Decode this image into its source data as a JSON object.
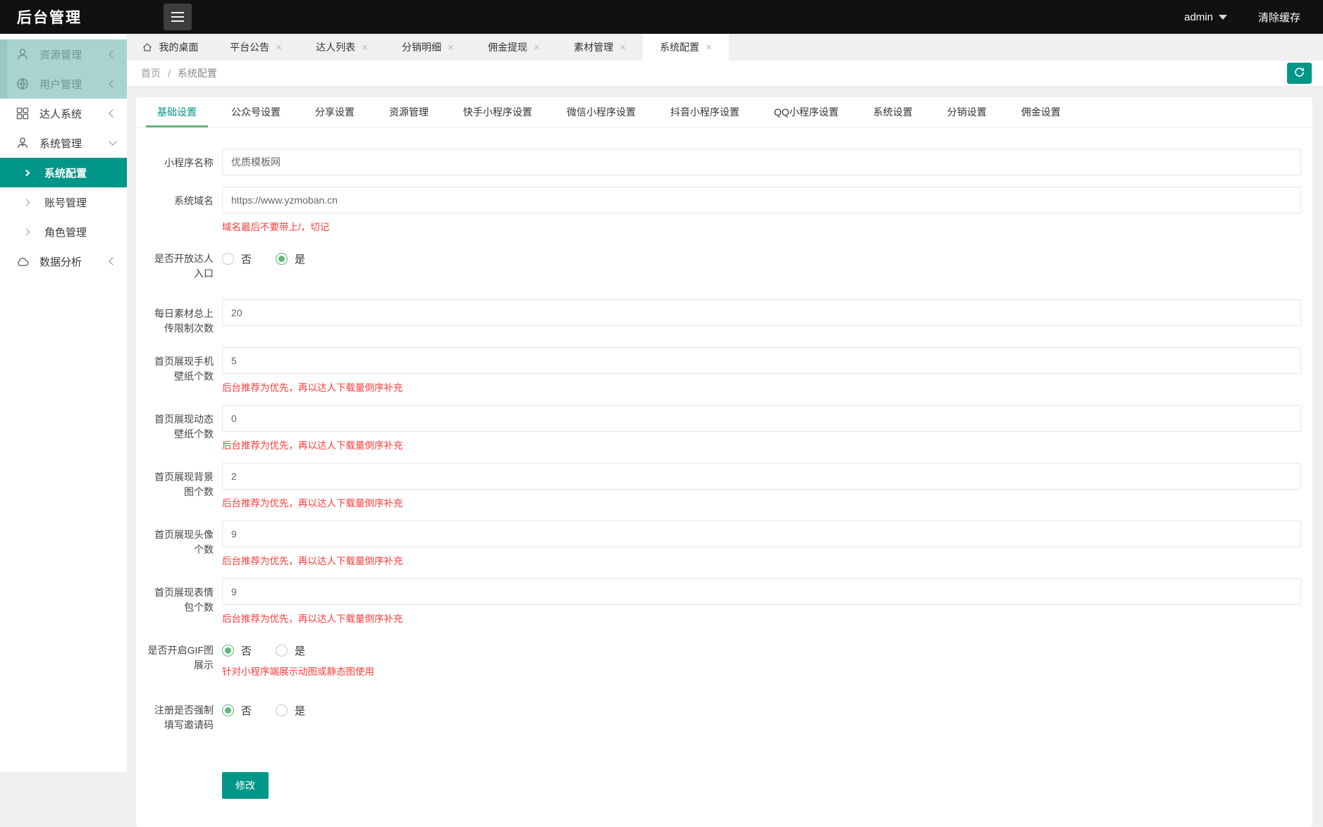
{
  "colors": {
    "accent_teal": "#009688",
    "tab_underline_green": "#5FB878",
    "hint_red": "#ff3c3c",
    "topbar_bg": "#111111",
    "sidebar_highlight": "#a9d4ce",
    "page_bg": "#f0f0f0"
  },
  "icons": {
    "hamburger": "three-bars",
    "caret-down": "▼",
    "home": "house-outline",
    "close": "×",
    "refresh": "circular-arrow",
    "chevron-collapsed": "‹",
    "chevron-expanded": "⌄",
    "submenu-arrow": "›"
  },
  "topbar": {
    "title": "后台管理",
    "user": "admin",
    "clear_cache_label": "清除缓存"
  },
  "window_tabs": [
    {
      "label": "我的桌面",
      "closable": false,
      "active": false
    },
    {
      "label": "平台公告",
      "closable": true,
      "active": false
    },
    {
      "label": "达人列表",
      "closable": true,
      "active": false
    },
    {
      "label": "分销明细",
      "closable": true,
      "active": false
    },
    {
      "label": "佣金提现",
      "closable": true,
      "active": false
    },
    {
      "label": "素材管理",
      "closable": true,
      "active": false
    },
    {
      "label": "系统配置",
      "closable": true,
      "active": true
    }
  ],
  "breadcrumb": {
    "home": "首页",
    "separator": "/",
    "current": "系统配置"
  },
  "sidebar": {
    "items": [
      {
        "label": "资源管理",
        "icon": "user-icon",
        "highlight": true,
        "chevron": "left"
      },
      {
        "label": "用户管理",
        "icon": "globe-icon",
        "highlight": true,
        "chevron": "left"
      },
      {
        "label": "达人系统",
        "icon": "grid-icon",
        "highlight": false,
        "chevron": "left"
      },
      {
        "label": "系统管理",
        "icon": "user-tie-icon",
        "highlight": false,
        "chevron": "down",
        "expanded": true
      },
      {
        "label": "系统配置",
        "type": "sub",
        "active": true
      },
      {
        "label": "账号管理",
        "type": "sub",
        "active": false
      },
      {
        "label": "角色管理",
        "type": "sub",
        "active": false
      },
      {
        "label": "数据分析",
        "icon": "cloud-icon",
        "highlight": false,
        "chevron": "left"
      }
    ]
  },
  "content_tabs": [
    {
      "label": "基础设置",
      "active": true
    },
    {
      "label": "公众号设置",
      "active": false
    },
    {
      "label": "分享设置",
      "active": false
    },
    {
      "label": "资源管理",
      "active": false
    },
    {
      "label": "快手小程序设置",
      "active": false
    },
    {
      "label": "微信小程序设置",
      "active": false
    },
    {
      "label": "抖音小程序设置",
      "active": false
    },
    {
      "label": "QQ小程序设置",
      "active": false
    },
    {
      "label": "系统设置",
      "active": false
    },
    {
      "label": "分销设置",
      "active": false
    },
    {
      "label": "佣金设置",
      "active": false
    }
  ],
  "form": {
    "items": [
      {
        "label": "小程序名称",
        "type": "text",
        "value": "优质模板网"
      },
      {
        "label": "系统域名",
        "type": "text",
        "value": "https://www.yzmoban.cn",
        "hint": "域名最后不要带上/，切记"
      },
      {
        "label": "是否开放达人入口",
        "type": "radio",
        "options": [
          "否",
          "是"
        ],
        "selected": "是"
      },
      {
        "label": "每日素材总上传限制次数",
        "type": "text",
        "value": "20"
      },
      {
        "label": "首页展现手机壁纸个数",
        "type": "text",
        "value": "5",
        "hint": "后台推荐为优先，再以达人下载量倒序补充"
      },
      {
        "label": "首页展现动态壁纸个数",
        "type": "text",
        "value": "0",
        "hint": "后台推荐为优先，再以达人下载量倒序补充"
      },
      {
        "label": "首页展现背景图个数",
        "type": "text",
        "value": "2",
        "hint": "后台推荐为优先，再以达人下载量倒序补充"
      },
      {
        "label": "首页展现头像个数",
        "type": "text",
        "value": "9",
        "hint": "后台推荐为优先，再以达人下载量倒序补充"
      },
      {
        "label": "首页展现表情包个数",
        "type": "text",
        "value": "9",
        "hint": "后台推荐为优先，再以达人下载量倒序补充"
      },
      {
        "label": "是否开启GIF图展示",
        "type": "radio",
        "options": [
          "否",
          "是"
        ],
        "selected": "否",
        "hint": "针对小程序端展示动图或静态图使用"
      },
      {
        "label": "注册是否强制填写邀请码",
        "type": "radio",
        "options": [
          "否",
          "是"
        ],
        "selected": "否"
      }
    ],
    "submit_label": "修改"
  }
}
